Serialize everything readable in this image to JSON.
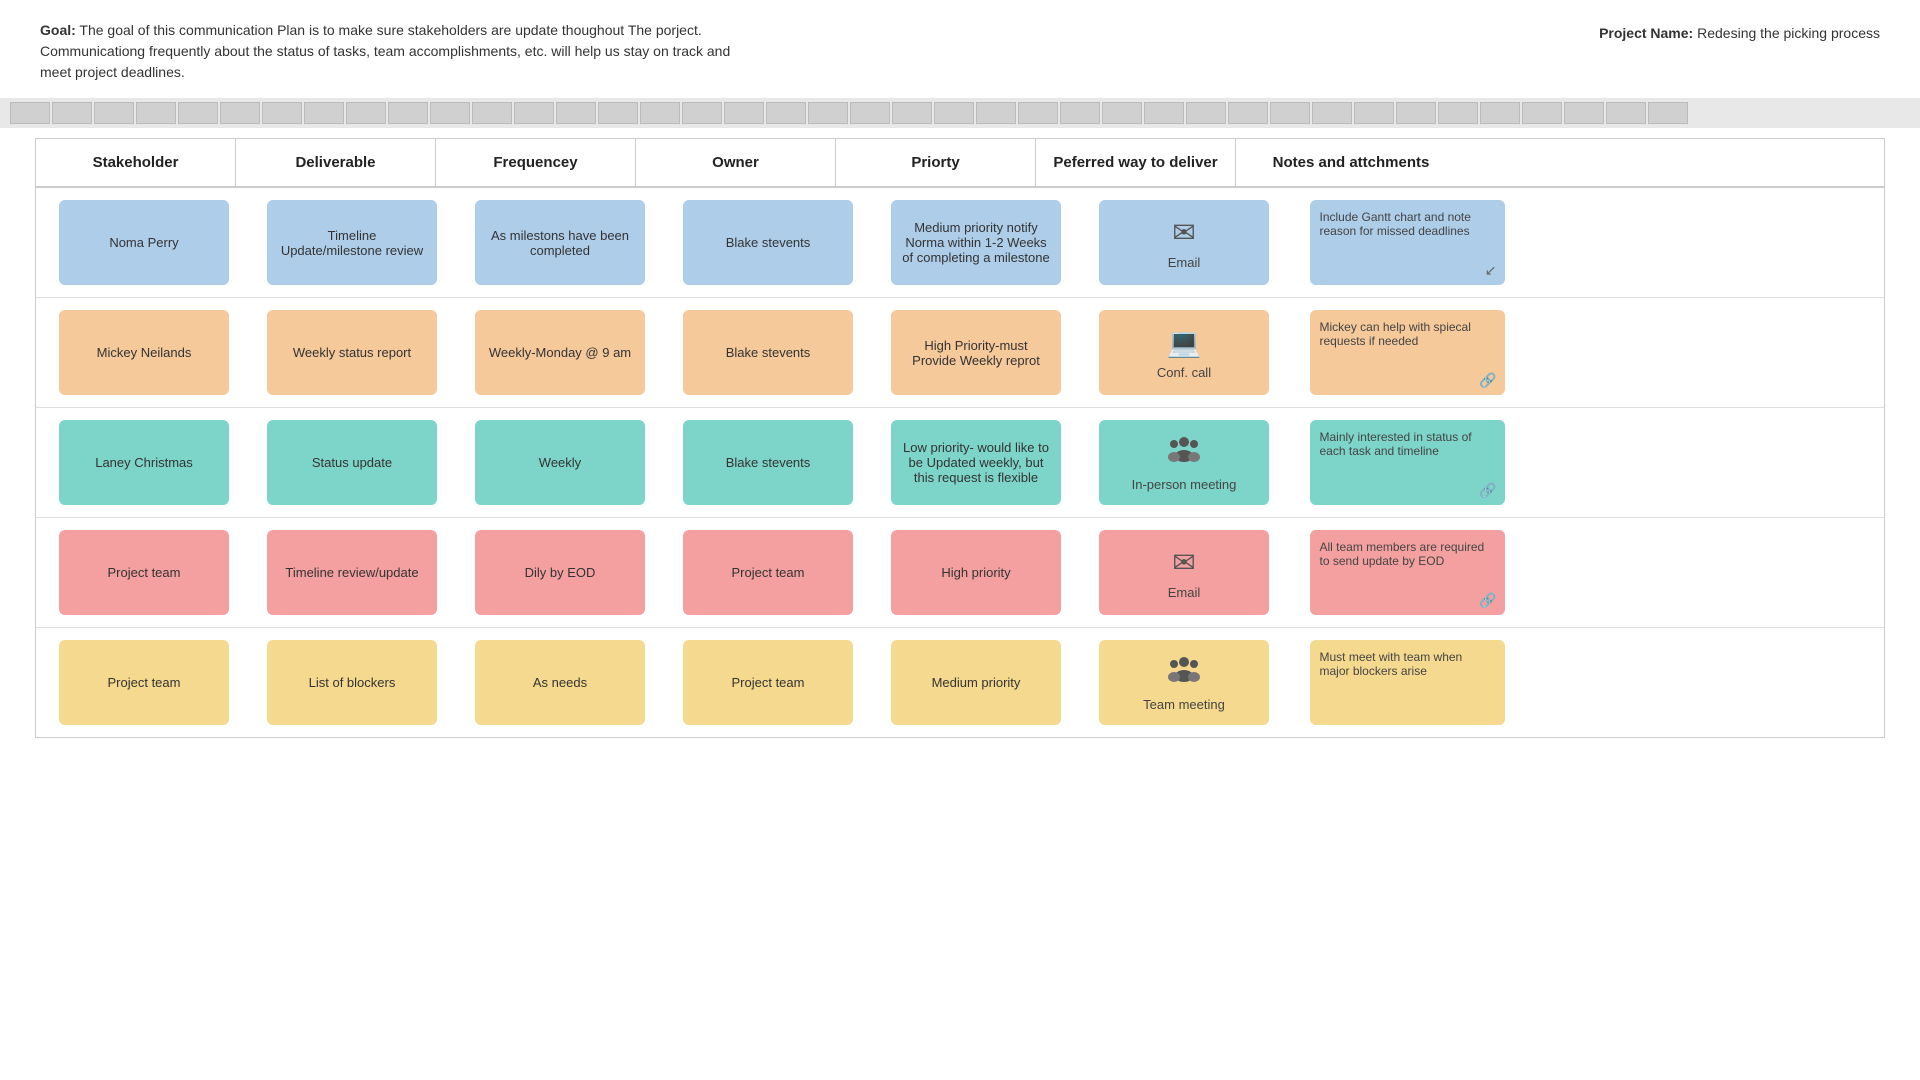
{
  "header": {
    "goal_label": "Goal:",
    "goal_text": " The goal of this communication Plan is to make sure stakeholders are update thoughout The porject. Communicationg frequently about the status of tasks, team accomplishments, etc. will help us stay on track and meet project deadlines.",
    "project_label": "Project Name:",
    "project_name": " Redesing the picking process"
  },
  "table": {
    "columns": [
      "Stakeholder",
      "Deliverable",
      "Frequencey",
      "Owner",
      "Priorty",
      "Peferred way to deliver",
      "Notes and attchments"
    ],
    "rows": [
      {
        "stakeholder": "Noma Perry",
        "deliverable": "Timeline Update/milestone review",
        "frequency": "As milestons have been completed",
        "owner": "Blake stevents",
        "priority": "Medium priority notify Norma within 1-2 Weeks of completing a milestone",
        "deliver_method": "Email",
        "deliver_icon": "email",
        "notes": "Include Gantt chart and note reason for missed deadlines",
        "has_cursor": true
      },
      {
        "stakeholder": "Mickey Neilands",
        "deliverable": "Weekly status report",
        "frequency": "Weekly-Monday @ 9 am",
        "owner": "Blake stevents",
        "priority": "High Priority-must Provide Weekly reprot",
        "deliver_method": "Conf. call",
        "deliver_icon": "laptop",
        "notes": "Mickey can help with spiecal requests if needed",
        "has_link": true
      },
      {
        "stakeholder": "Laney Christmas",
        "deliverable": "Status update",
        "frequency": "Weekly",
        "owner": "Blake stevents",
        "priority": "Low priority- would like to be Updated weekly, but this request is flexible",
        "deliver_method": "In-person meeting",
        "deliver_icon": "meeting",
        "notes": "Mainly interested in status of each task and timeline",
        "has_link": true
      },
      {
        "stakeholder": "Project team",
        "deliverable": "Timeline review/update",
        "frequency": "Dily by EOD",
        "owner": "Project team",
        "priority": "High priority",
        "deliver_method": "Email",
        "deliver_icon": "email",
        "notes": "All team members are required to send update by EOD",
        "has_link": true
      },
      {
        "stakeholder": "Project team",
        "deliverable": "List of blockers",
        "frequency": "As needs",
        "owner": "Project team",
        "priority": "Medium priority",
        "deliver_method": "Team meeting",
        "deliver_icon": "team",
        "notes": "Must meet with team when major blockers arise",
        "has_link": false
      }
    ]
  }
}
